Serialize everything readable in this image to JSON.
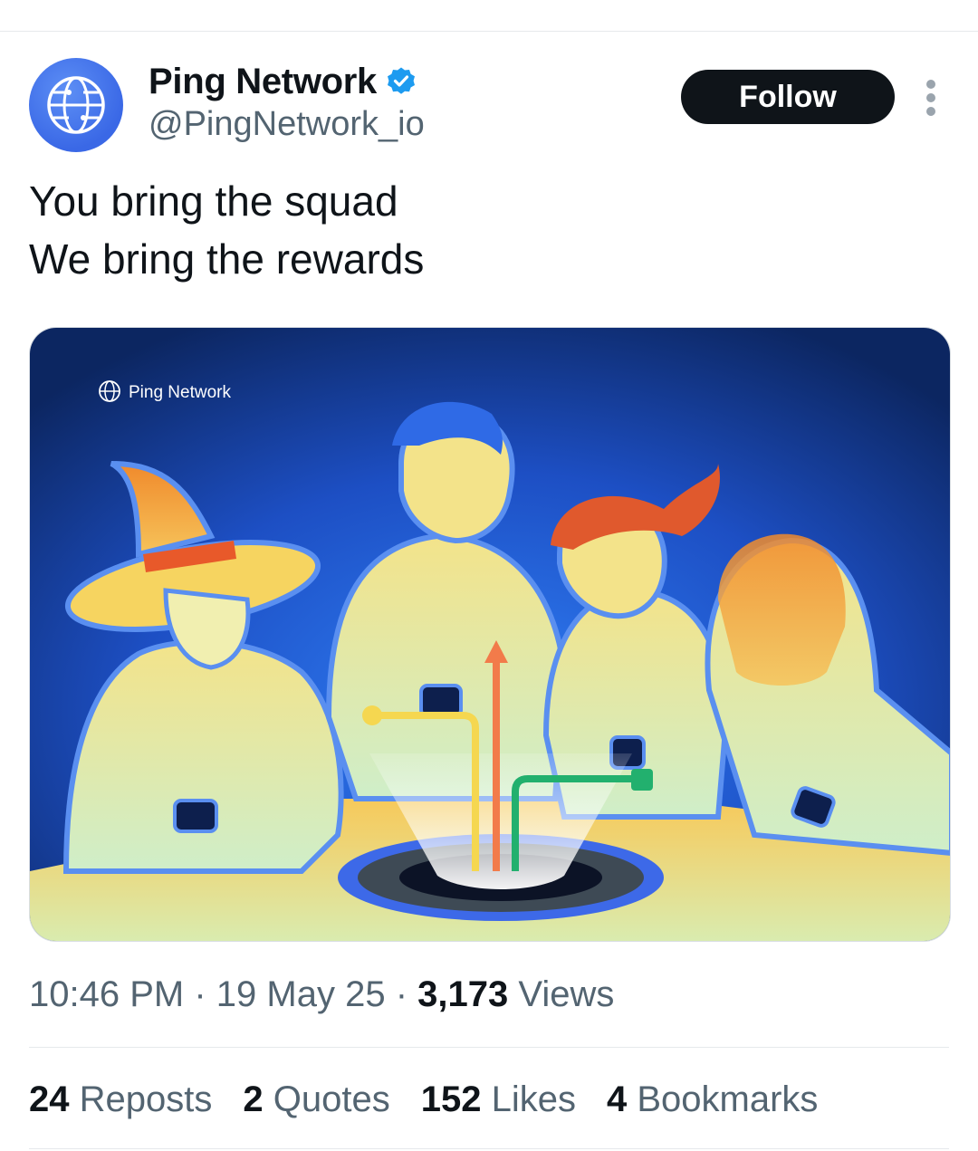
{
  "author": {
    "display_name": "Ping Network",
    "handle": "@PingNetwork_io",
    "avatar_icon": "globe-network-icon",
    "verified_icon": "verified-badge-icon"
  },
  "actions": {
    "follow_label": "Follow",
    "more_icon": "more-vertical-icon"
  },
  "tweet": {
    "lines": [
      "You bring the squad",
      "We bring the rewards"
    ]
  },
  "media": {
    "watermark": "Ping Network"
  },
  "meta": {
    "time": "10:46 PM",
    "date": "19 May 25",
    "views_count": "3,173",
    "views_label": "Views"
  },
  "stats": {
    "reposts_count": "24",
    "reposts_label": "Reposts",
    "quotes_count": "2",
    "quotes_label": "Quotes",
    "likes_count": "152",
    "likes_label": "Likes",
    "bookmarks_count": "4",
    "bookmarks_label": "Bookmarks"
  },
  "colors": {
    "accent": "#1d9bf0",
    "follow_bg": "#0f1419",
    "secondary_text": "#536471",
    "brand_blue": "#3a68e6"
  }
}
